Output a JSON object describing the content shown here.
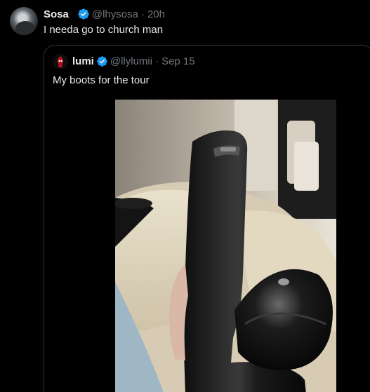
{
  "tweet": {
    "author_name": "Sosa",
    "author_handle": "@lhysosa",
    "separator": "·",
    "time": "20h",
    "text": "I needa go to church man"
  },
  "quoted": {
    "author_name": "lumi",
    "author_handle": "@llylumii",
    "separator": "·",
    "date": "Sep 15",
    "text": "My boots for the tour"
  },
  "colors": {
    "background": "#000000",
    "text_primary": "#e7e9ea",
    "text_secondary": "#71767b",
    "verified_badge": "#1d9bf0",
    "quote_border": "#2f3336"
  },
  "icons": {
    "verified": "verified-badge-icon"
  }
}
